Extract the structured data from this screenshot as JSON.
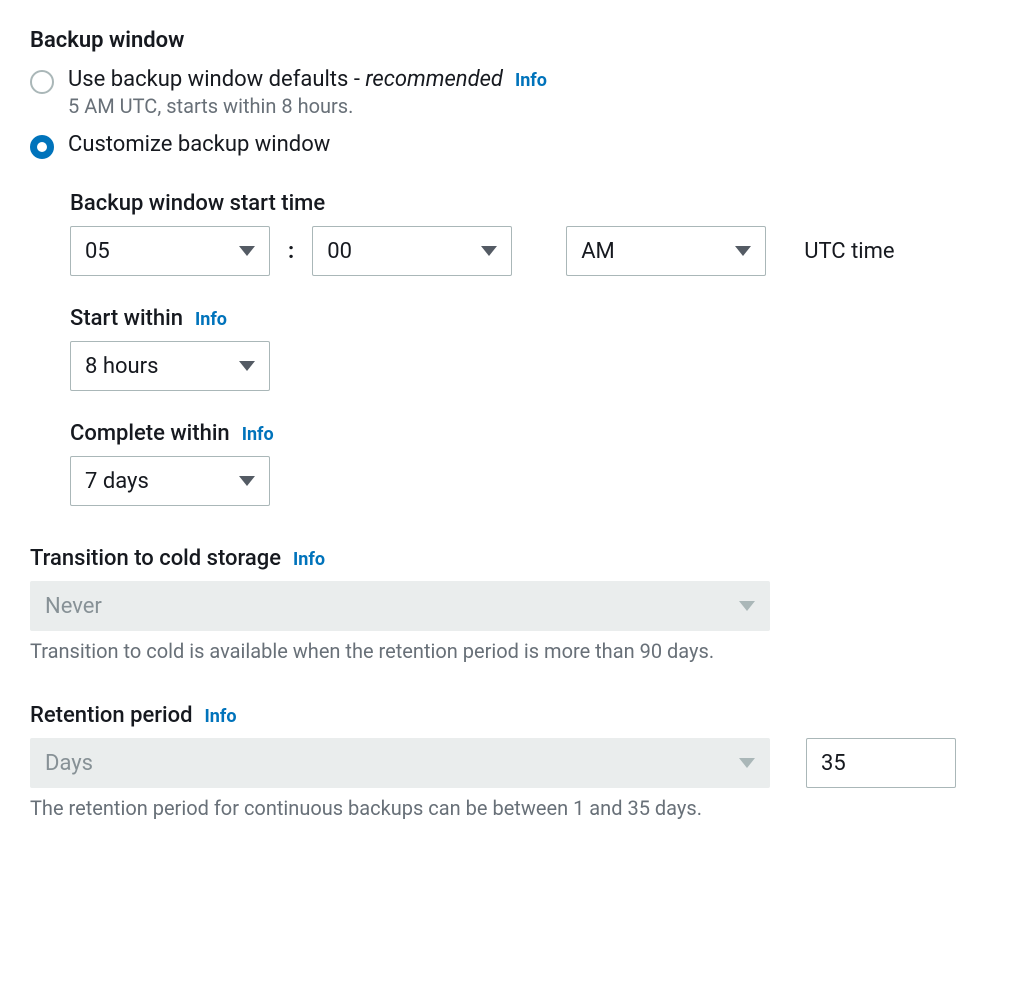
{
  "backup_window": {
    "heading": "Backup window",
    "options": {
      "defaults": {
        "label": "Use backup window defaults -",
        "emph": "recommended",
        "info": "Info",
        "sub": "5 AM UTC, starts within 8 hours."
      },
      "customize": {
        "label": "Customize backup window"
      }
    },
    "start_time": {
      "label": "Backup window start time",
      "hour": "05",
      "minute": "00",
      "ampm": "AM",
      "utc_text": "UTC time",
      "colon": ":"
    },
    "start_within": {
      "label": "Start within",
      "info": "Info",
      "value": "8 hours"
    },
    "complete_within": {
      "label": "Complete within",
      "info": "Info",
      "value": "7 days"
    }
  },
  "cold_storage": {
    "label": "Transition to cold storage",
    "info": "Info",
    "value": "Never",
    "help": "Transition to cold is available when the retention period is more than 90 days."
  },
  "retention": {
    "label": "Retention period",
    "info": "Info",
    "unit": "Days",
    "value": "35",
    "help": "The retention period for continuous backups can be between 1 and 35 days."
  }
}
